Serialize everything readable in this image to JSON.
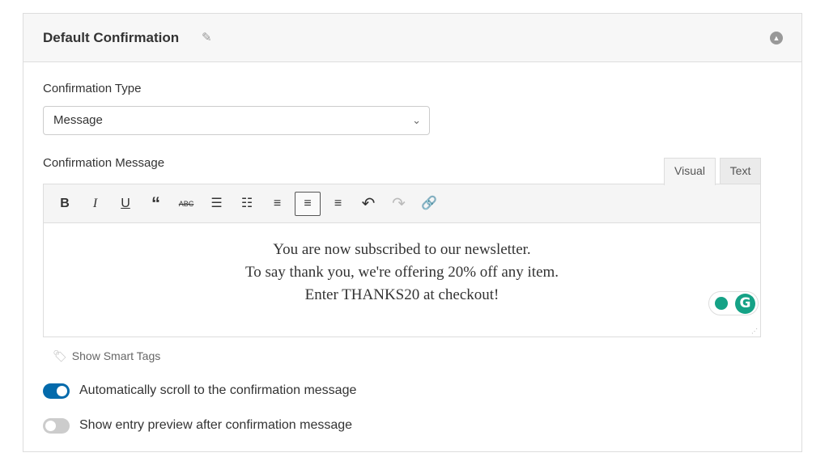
{
  "header": {
    "title": "Default Confirmation",
    "edit_icon": "pencil-icon",
    "collapse_icon": "chevron-up-circle-icon"
  },
  "confirmation_type": {
    "label": "Confirmation Type",
    "value": "Message"
  },
  "confirmation_message": {
    "label": "Confirmation Message",
    "tabs": [
      {
        "label": "Visual",
        "active": true
      },
      {
        "label": "Text",
        "active": false
      }
    ],
    "toolbar": [
      {
        "name": "bold",
        "glyph": "B"
      },
      {
        "name": "italic",
        "glyph": "I"
      },
      {
        "name": "underline",
        "glyph": "U"
      },
      {
        "name": "blockquote",
        "glyph": "❝"
      },
      {
        "name": "strikethrough",
        "glyph": "ABC"
      },
      {
        "name": "bullet-list",
        "glyph": "☰"
      },
      {
        "name": "numbered-list",
        "glyph": "☷"
      },
      {
        "name": "align-left",
        "glyph": "≡"
      },
      {
        "name": "align-center",
        "glyph": "≡",
        "active": true
      },
      {
        "name": "align-right",
        "glyph": "≡"
      },
      {
        "name": "undo",
        "glyph": "↶"
      },
      {
        "name": "redo",
        "glyph": "↷"
      },
      {
        "name": "link",
        "glyph": "🔗"
      }
    ],
    "lines": [
      "You are now subscribed to our newsletter.",
      "To say thank you, we're offering 20% off any item.",
      "Enter THANKS20 at checkout!"
    ]
  },
  "smart_tags": "Show Smart Tags",
  "toggles": [
    {
      "label": "Automatically scroll to the confirmation message",
      "on": true
    },
    {
      "label": "Show entry preview after confirmation message",
      "on": false
    }
  ],
  "colors": {
    "toggle_on": "#036aab",
    "toggle_off": "#ccc",
    "grammarly": "#15a286"
  }
}
